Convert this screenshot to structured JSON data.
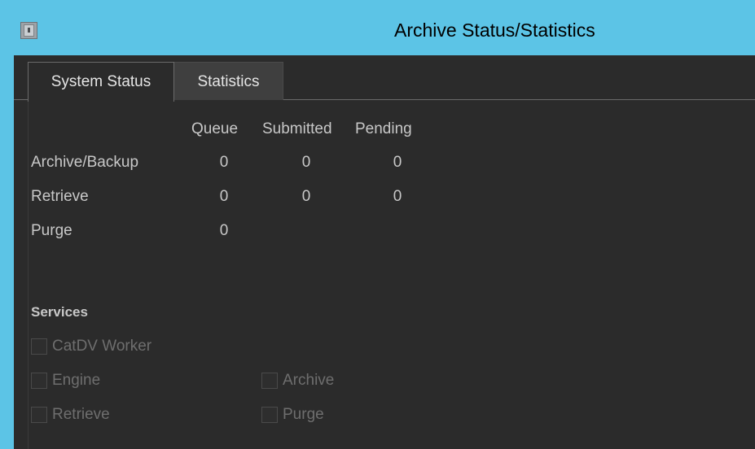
{
  "window": {
    "title": "Archive Status/Statistics",
    "icon": "archive-app-icon"
  },
  "tabs": [
    {
      "label": "System Status",
      "selected": true
    },
    {
      "label": "Statistics",
      "selected": false
    }
  ],
  "status_table": {
    "columns": [
      "Queue",
      "Submitted",
      "Pending"
    ],
    "rows": [
      {
        "label": "Archive/Backup",
        "queue": "0",
        "submitted": "0",
        "pending": "0"
      },
      {
        "label": "Retrieve",
        "queue": "0",
        "submitted": "0",
        "pending": "0"
      },
      {
        "label": "Purge",
        "queue": "0"
      }
    ]
  },
  "services": {
    "heading": "Services",
    "items": [
      {
        "label": "CatDV Worker",
        "checked": false,
        "enabled": false
      },
      {
        "label": "Engine",
        "checked": false,
        "enabled": false
      },
      {
        "label": "Archive",
        "checked": false,
        "enabled": false
      },
      {
        "label": "Retrieve",
        "checked": false,
        "enabled": false
      },
      {
        "label": "Purge",
        "checked": false,
        "enabled": false
      }
    ]
  },
  "colors": {
    "titlebar": "#5cc4e6",
    "panel_background": "#2b2b2b",
    "text": "#c8c8c8",
    "disabled_text": "#6e6e6e"
  }
}
